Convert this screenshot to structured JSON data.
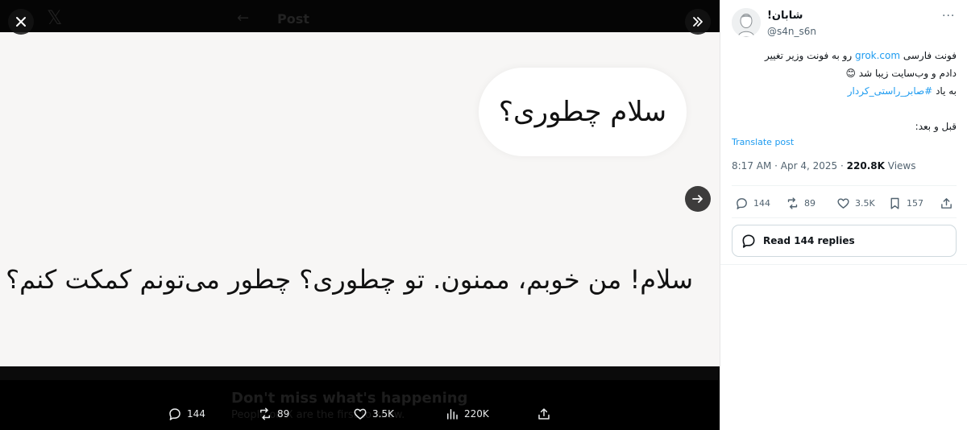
{
  "viewer": {
    "header_title": "Post",
    "bubble_text": "سلام چطوری؟",
    "answer_text": "سلام! من خوبم، ممنون. تو چطوری؟ چطور می‌تونم کمکت کنم؟",
    "banner_title": "Don't miss what's happening",
    "banner_subtitle": "People on X are the first to know.",
    "actions": {
      "replies": "144",
      "reposts": "89",
      "likes": "3.5K",
      "views": "220K"
    }
  },
  "tweet": {
    "author_name": "شابان!",
    "handle": "@s4n_s6n",
    "text_line1_after_link": " رو به فونت وزیر تغییر",
    "text_line1_before_link": "فونت فارسی ",
    "link_domain": "grok.com",
    "text_line2": "دادم و وب‌سایت زیبا شد 😊",
    "text_line3_prefix": "به یاد ",
    "hashtag": "#صابر_راستی_کردار",
    "text_line4": "قبل و بعد:",
    "translate_label": "Translate post",
    "time": "8:17 AM",
    "date": "Apr 4, 2025",
    "views_count": "220.8K",
    "views_label": "Views",
    "replies": "144",
    "reposts": "89",
    "likes": "3.5K",
    "bookmarks": "157",
    "read_replies_label": "Read 144 replies"
  },
  "icons": {
    "close": "close-icon",
    "collapse": "double-chevron-right-icon",
    "next": "arrow-right-icon",
    "reply": "speech-bubble-icon",
    "repost": "repost-icon",
    "like": "heart-icon",
    "views": "bar-chart-icon",
    "bookmark": "bookmark-icon",
    "share": "share-icon"
  },
  "colors": {
    "accent": "#1d9bf0",
    "viewer_bg": "#000000",
    "image_bg": "#f7f6f5"
  }
}
